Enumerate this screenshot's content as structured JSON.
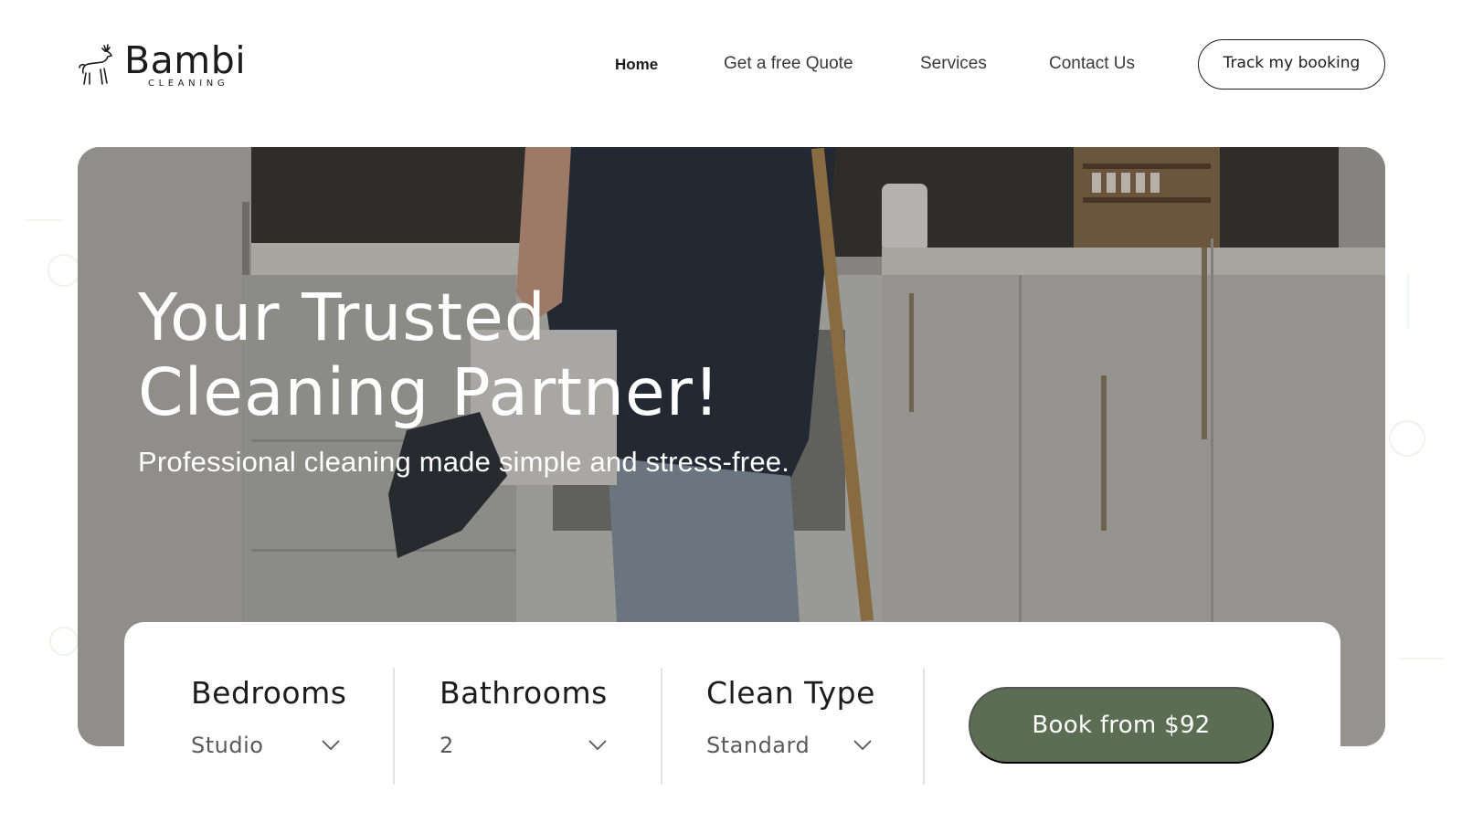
{
  "brand": {
    "name": "Bambi",
    "tagline": "CLEANING",
    "logo_icon": "deer-icon"
  },
  "nav": {
    "items": [
      {
        "label": "Home",
        "active": true
      },
      {
        "label": "Get a free Quote",
        "active": false
      },
      {
        "label": "Services",
        "active": false
      },
      {
        "label": "Contact Us",
        "active": false
      }
    ],
    "cta_label": "Track my booking"
  },
  "hero": {
    "title_line1": "Your Trusted",
    "title_line2": "Cleaning Partner!",
    "subtitle": "Professional cleaning made simple and stress-free."
  },
  "booking": {
    "bedrooms": {
      "label": "Bedrooms",
      "value": "Studio"
    },
    "bathrooms": {
      "label": "Bathrooms",
      "value": "2"
    },
    "clean_type": {
      "label": "Clean Type",
      "value": "Standard"
    },
    "book_label": "Book from $92"
  },
  "colors": {
    "accent": "#5b6d52",
    "text": "#1c1c1c",
    "background": "#ffffff"
  }
}
